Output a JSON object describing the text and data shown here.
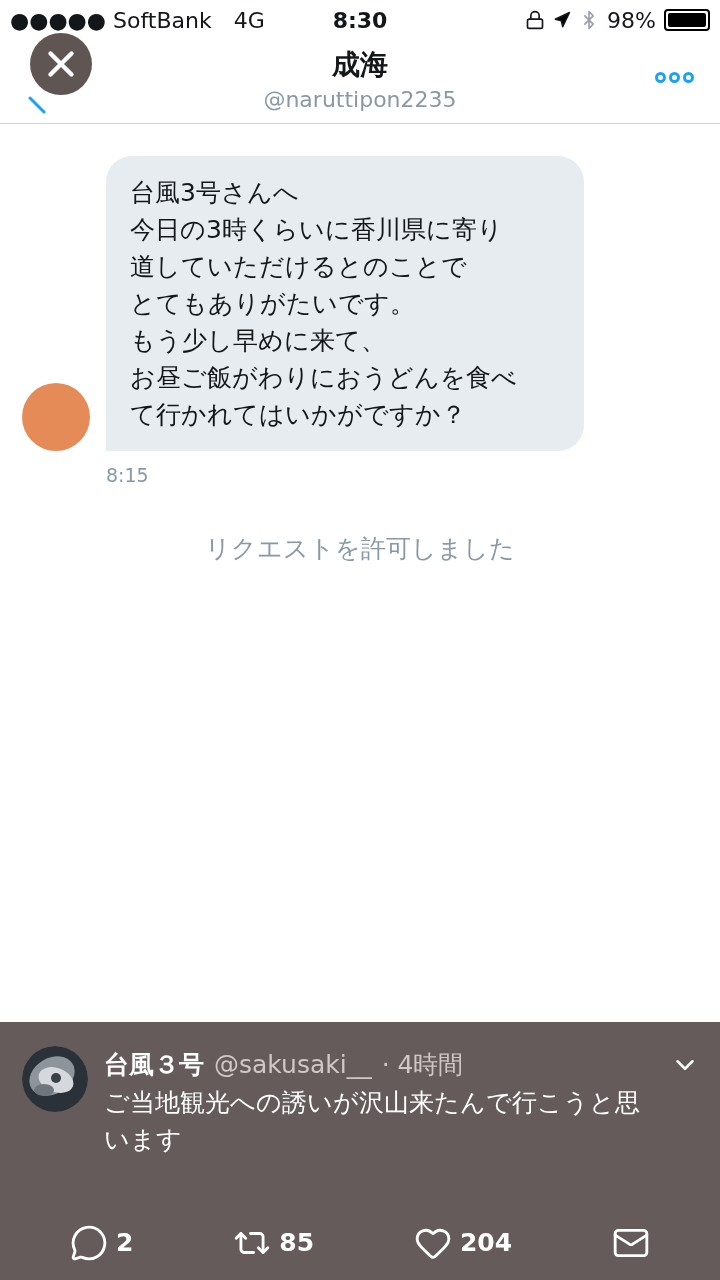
{
  "status_bar": {
    "carrier": "●●●●● SoftBank",
    "network": "4G",
    "time": "8:30",
    "battery": "98%"
  },
  "header": {
    "title": "成海",
    "handle": "@naruttipon2235"
  },
  "messages": [
    {
      "lines": [
        "台風3号さんへ",
        "今日の3時くらいに香川県に寄り",
        "道していただけるとのことで",
        "とてもありがたいです。",
        "もう少し早めに来て、",
        "お昼ご飯がわりにおうどんを食べ",
        "て行かれてはいかがですか？"
      ],
      "time": "8:15"
    }
  ],
  "system_notice": "リクエストを許可しました",
  "notification": {
    "name": "台風３号",
    "handle": "@sakusaki__",
    "time": "· 4時間",
    "text": "ご当地観光への誘いが沢山来たんで行こうと思います",
    "actions": [
      {
        "kind": "reply",
        "count": "2"
      },
      {
        "kind": "retweet",
        "count": "85"
      },
      {
        "kind": "like",
        "count": "204"
      },
      {
        "kind": "dm"
      }
    ]
  }
}
